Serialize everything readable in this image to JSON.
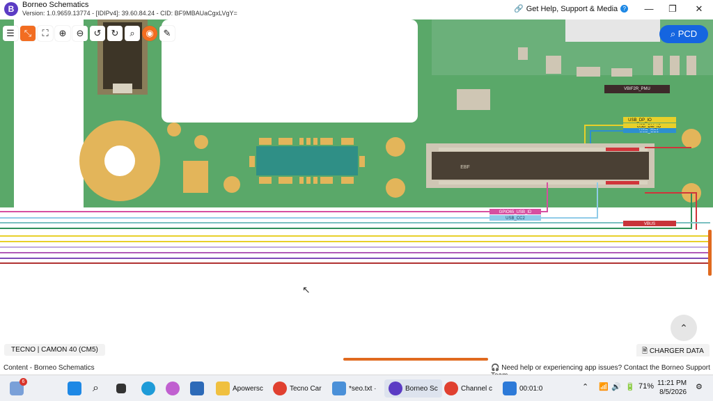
{
  "titlebar": {
    "app_name": "Borneo Schematics",
    "version": "Version: 1.0.9659.13774 - [IDIPv4]: 39.60.84.24 - CID: BF9MBAUaCgxLVgY=",
    "help": "Get Help, Support & Media",
    "minimize": "—",
    "maximize": "❐",
    "close": "✕"
  },
  "pcd_button": "PCD",
  "net_labels": {
    "usb_dp": "USB_DP_IO",
    "usb_dm": "USB_DM_IO",
    "usb_cc1": "USB_CC1",
    "gpio": "GPIO65_USB_ID",
    "usb_cc2": "USB_CC2",
    "vbus": "VBUS",
    "vbif": "VBIF2R_PMU",
    "ebf": "EBF"
  },
  "device_label": "TECNO | CAMON 40 (CM5)",
  "charger_button": "CHARGER DATA",
  "status": {
    "left": "Content - Borneo Schematics",
    "right": "Need help or experiencing app issues? Contact the Borneo Support Team."
  },
  "taskbar": {
    "weather_badge": "6",
    "apps": [
      {
        "label": "Apowersc"
      },
      {
        "label": "Tecno Car"
      },
      {
        "label": "*seo.txt ·"
      },
      {
        "label": "Borneo Sc"
      },
      {
        "label": "Channel c"
      },
      {
        "label": "00:01:0"
      }
    ],
    "battery": "71%",
    "time": "11:21 PM",
    "date": "8/5/2026"
  },
  "colors": {
    "accent": "#f26d21",
    "pcd_blue": "#1565e0",
    "pcb_green": "#5aa869",
    "pad_gold": "#e3b55a"
  }
}
